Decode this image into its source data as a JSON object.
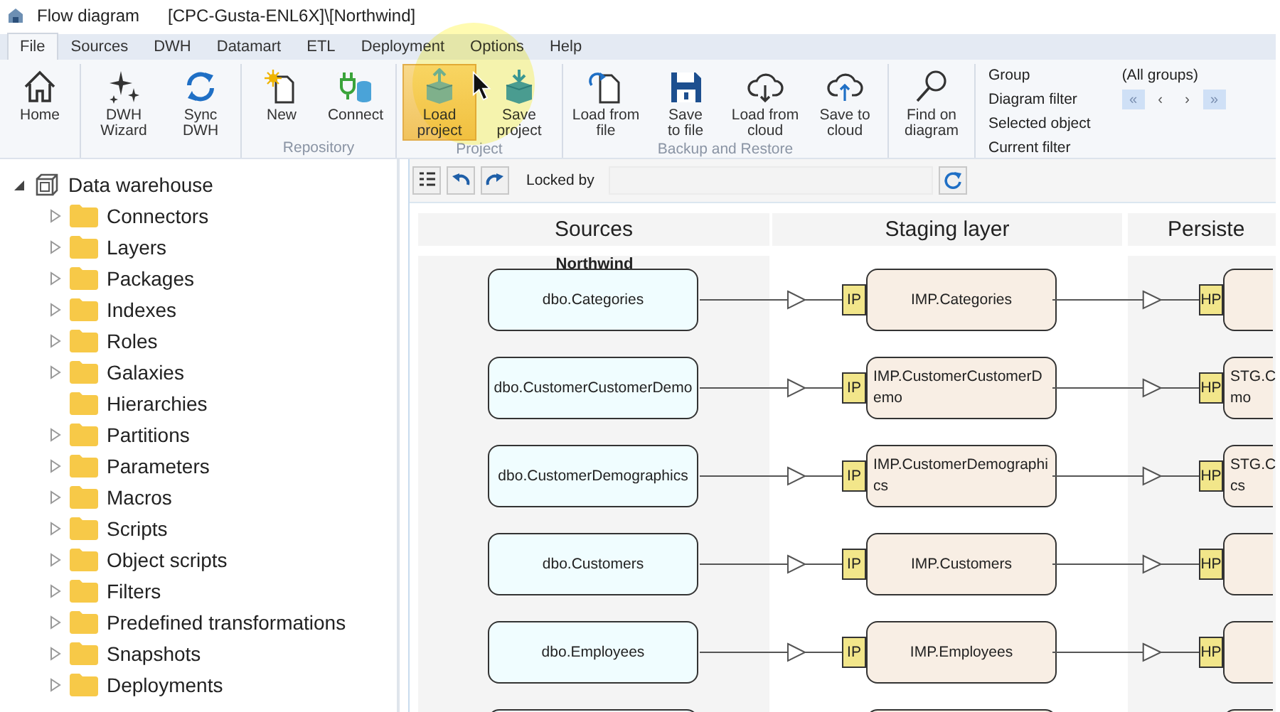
{
  "window": {
    "title": "Flow diagram",
    "path": "[CPC-Gusta-ENL6X]\\[Northwind]"
  },
  "tabs": [
    {
      "label": "File",
      "selected": true
    },
    {
      "label": "Sources",
      "selected": false
    },
    {
      "label": "DWH",
      "selected": false
    },
    {
      "label": "Datamart",
      "selected": false
    },
    {
      "label": "ETL",
      "selected": false
    },
    {
      "label": "Deployment",
      "selected": false
    },
    {
      "label": "Options",
      "selected": false
    },
    {
      "label": "Help",
      "selected": false
    }
  ],
  "ribbon_groups": [
    {
      "buttons": [
        {
          "kind": "home",
          "label": "Home",
          "highlighted": false
        }
      ]
    },
    {
      "buttons": [
        {
          "kind": "wizard",
          "label": "DWH\nWizard",
          "highlighted": false
        },
        {
          "kind": "sync",
          "label": "Sync\nDWH",
          "highlighted": false
        }
      ]
    },
    {
      "label": "Repository",
      "buttons": [
        {
          "kind": "new",
          "label": "New",
          "highlighted": false
        },
        {
          "kind": "connect",
          "label": "Connect",
          "highlighted": false
        }
      ]
    },
    {
      "label": "Project",
      "buttons": [
        {
          "kind": "load-project",
          "label": "Load\nproject",
          "highlighted": true
        },
        {
          "kind": "save-project",
          "label": "Save\nproject",
          "highlighted": false
        }
      ]
    },
    {
      "label": "Backup and Restore",
      "buttons": [
        {
          "kind": "load-file",
          "label": "Load from\nfile",
          "highlighted": false
        },
        {
          "kind": "save-file",
          "label": "Save\nto file",
          "highlighted": false
        },
        {
          "kind": "load-cloud",
          "label": "Load from\ncloud",
          "highlighted": false
        },
        {
          "kind": "save-cloud",
          "label": "Save to\ncloud",
          "highlighted": false
        }
      ]
    },
    {
      "buttons": [
        {
          "kind": "find",
          "label": "Find on\ndiagram",
          "highlighted": false
        }
      ]
    }
  ],
  "filter_panel": {
    "group_label": "Group",
    "group_value": "(All groups)",
    "diagram_filter_label": "Diagram filter",
    "nav": [
      {
        "label": "«",
        "highlighted": true
      },
      {
        "label": "‹",
        "highlighted": false
      },
      {
        "label": "›",
        "highlighted": false
      },
      {
        "label": "»",
        "highlighted": true
      }
    ],
    "selected_object_label": "Selected object",
    "current_filter_label": "Current filter"
  },
  "tree": {
    "label": "Data warehouse",
    "expanded": true,
    "children": [
      {
        "label": "Connectors",
        "expandable": true
      },
      {
        "label": "Layers",
        "expandable": true
      },
      {
        "label": "Packages",
        "expandable": true
      },
      {
        "label": "Indexes",
        "expandable": true
      },
      {
        "label": "Roles",
        "expandable": true
      },
      {
        "label": "Galaxies",
        "expandable": true
      },
      {
        "label": "Hierarchies",
        "expandable": false
      },
      {
        "label": "Partitions",
        "expandable": true
      },
      {
        "label": "Parameters",
        "expandable": true
      },
      {
        "label": "Macros",
        "expandable": true
      },
      {
        "label": "Scripts",
        "expandable": true
      },
      {
        "label": "Object scripts",
        "expandable": true
      },
      {
        "label": "Filters",
        "expandable": true
      },
      {
        "label": "Predefined transformations",
        "expandable": true
      },
      {
        "label": "Snapshots",
        "expandable": true
      },
      {
        "label": "Deployments",
        "expandable": true
      }
    ]
  },
  "diagram_toolbar": {
    "locked_by_label": "Locked by"
  },
  "diagram": {
    "columns": [
      {
        "title": "Sources",
        "group": "Northwind"
      },
      {
        "title": "Staging layer"
      },
      {
        "title": "Persiste"
      }
    ],
    "rows": [
      {
        "source": "dbo.Categories",
        "staging_badge": "IP",
        "staging": "IMP.Categories",
        "persisted_badge": "HP"
      },
      {
        "source": "dbo.CustomerCustomerDemo",
        "staging_badge": "IP",
        "staging": "IMP.CustomerCustomerDemo",
        "persisted_badge": "HP",
        "persisted_lines": [
          "STG.C",
          "mo"
        ]
      },
      {
        "source": "dbo.CustomerDemographics",
        "staging_badge": "IP",
        "staging": "IMP.CustomerDemographics",
        "persisted_badge": "HP",
        "persisted_lines": [
          "STG.C",
          "cs"
        ]
      },
      {
        "source": "dbo.Customers",
        "staging_badge": "IP",
        "staging": "IMP.Customers",
        "persisted_badge": "HP"
      },
      {
        "source": "dbo.Employees",
        "staging_badge": "IP",
        "staging": "IMP.Employees",
        "persisted_badge": "HP"
      },
      {}
    ]
  }
}
